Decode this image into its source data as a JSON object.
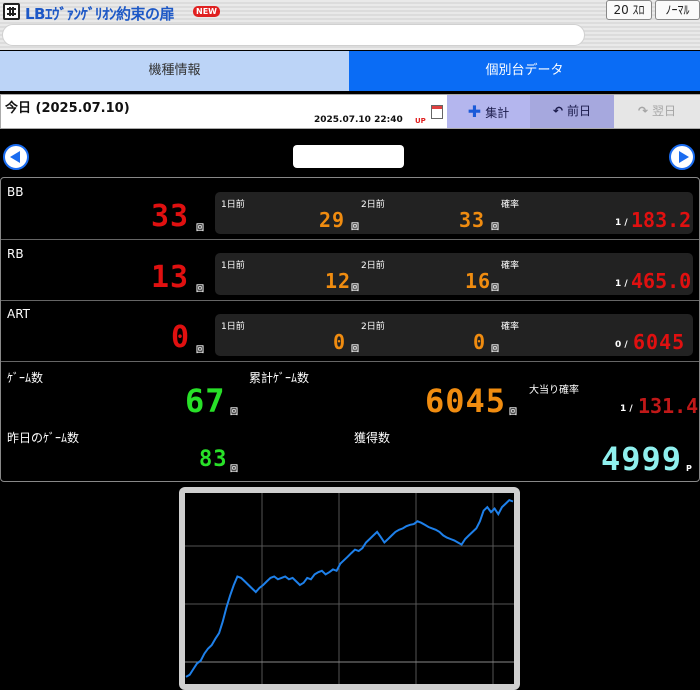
{
  "header": {
    "title": "LBｴｳﾞｧﾝｹﾞﾘｵﾝ約束の扉",
    "badge": "NEW",
    "count_label": "20 ｽﾛ",
    "mode_label": "ﾉｰﾏﾙ",
    "search_placeholder": ""
  },
  "tabs": [
    {
      "label": "機種情報",
      "active": false
    },
    {
      "label": "個別台データ",
      "active": true
    }
  ],
  "datebar": {
    "today_label": "今日 (2025.07.10)",
    "timestamp": "2025.07.10 22:40",
    "up_mark": "UP",
    "buttons": {
      "total": "集計",
      "prev": "前日",
      "next": "翌日"
    }
  },
  "machine_name": "",
  "stats": {
    "bb": {
      "label": "BB",
      "value": "33",
      "unit": "回",
      "sub": {
        "day1_label": "1日前",
        "day1_value": "29",
        "day2_label": "2日前",
        "day2_value": "33",
        "rate_label": "確率",
        "rate_prefix": "1 /",
        "rate_value": "183.2"
      }
    },
    "rb": {
      "label": "RB",
      "value": "13",
      "unit": "回",
      "sub": {
        "day1_label": "1日前",
        "day1_value": "12",
        "day2_label": "2日前",
        "day2_value": "16",
        "rate_label": "確率",
        "rate_prefix": "1 /",
        "rate_value": "465.0"
      }
    },
    "art": {
      "label": "ART",
      "value": "0",
      "unit": "回",
      "sub": {
        "day1_label": "1日前",
        "day1_value": "0",
        "day2_label": "2日前",
        "day2_value": "0",
        "rate_label": "確率",
        "rate_prefix": "0 /",
        "rate_value": "6045"
      }
    },
    "games": {
      "label": "ｹﾞｰﾑ数",
      "value": "67",
      "unit": "回"
    },
    "total_games": {
      "label": "累計ｹﾞｰﾑ数",
      "value": "6045",
      "unit": "回"
    },
    "hit_rate": {
      "label": "大当り確率",
      "prefix": "1 /",
      "value": "131.4"
    },
    "yesterday_games": {
      "label": "昨日のｹﾞｰﾑ数",
      "value": "83",
      "unit": "回"
    },
    "acquired": {
      "label": "獲得数",
      "value": "4999",
      "unit": "P"
    }
  },
  "colors": {
    "bb_red": "#e01010",
    "sub_orange": "#f08c10",
    "games_green": "#28e028",
    "acquired_cyan": "#8ff0ee",
    "hit_dark_red": "#c01818",
    "tab_active": "#0a6cf5",
    "line_blue": "#1e80ea"
  },
  "chart_data": {
    "type": "line",
    "series": [
      {
        "values": [
          0,
          30,
          110,
          190,
          230,
          330,
          400,
          450,
          540,
          620,
          780,
          980,
          1150,
          1300,
          1420,
          1400,
          1350,
          1300,
          1250,
          1200,
          1260,
          1300,
          1350,
          1400,
          1420,
          1380,
          1400,
          1420,
          1380,
          1400,
          1350,
          1300,
          1330,
          1400,
          1380,
          1450,
          1480,
          1500,
          1450,
          1480,
          1520,
          1500,
          1600,
          1650,
          1700,
          1750,
          1800,
          1780,
          1820,
          1900,
          1950,
          2000,
          2050,
          1980,
          1900,
          1950,
          2000,
          2050,
          2080,
          2100,
          2130,
          2150,
          2160,
          2200,
          2180,
          2150,
          2120,
          2100,
          2080,
          2050,
          2000,
          1970,
          1950,
          1930,
          1900,
          1870,
          1950,
          2000,
          2050,
          2100,
          2200,
          2350,
          2400,
          2330,
          2380,
          2300,
          2400,
          2450,
          2500,
          2480
        ]
      }
    ],
    "grid": true,
    "ylim": [
      -100,
      2600
    ]
  }
}
